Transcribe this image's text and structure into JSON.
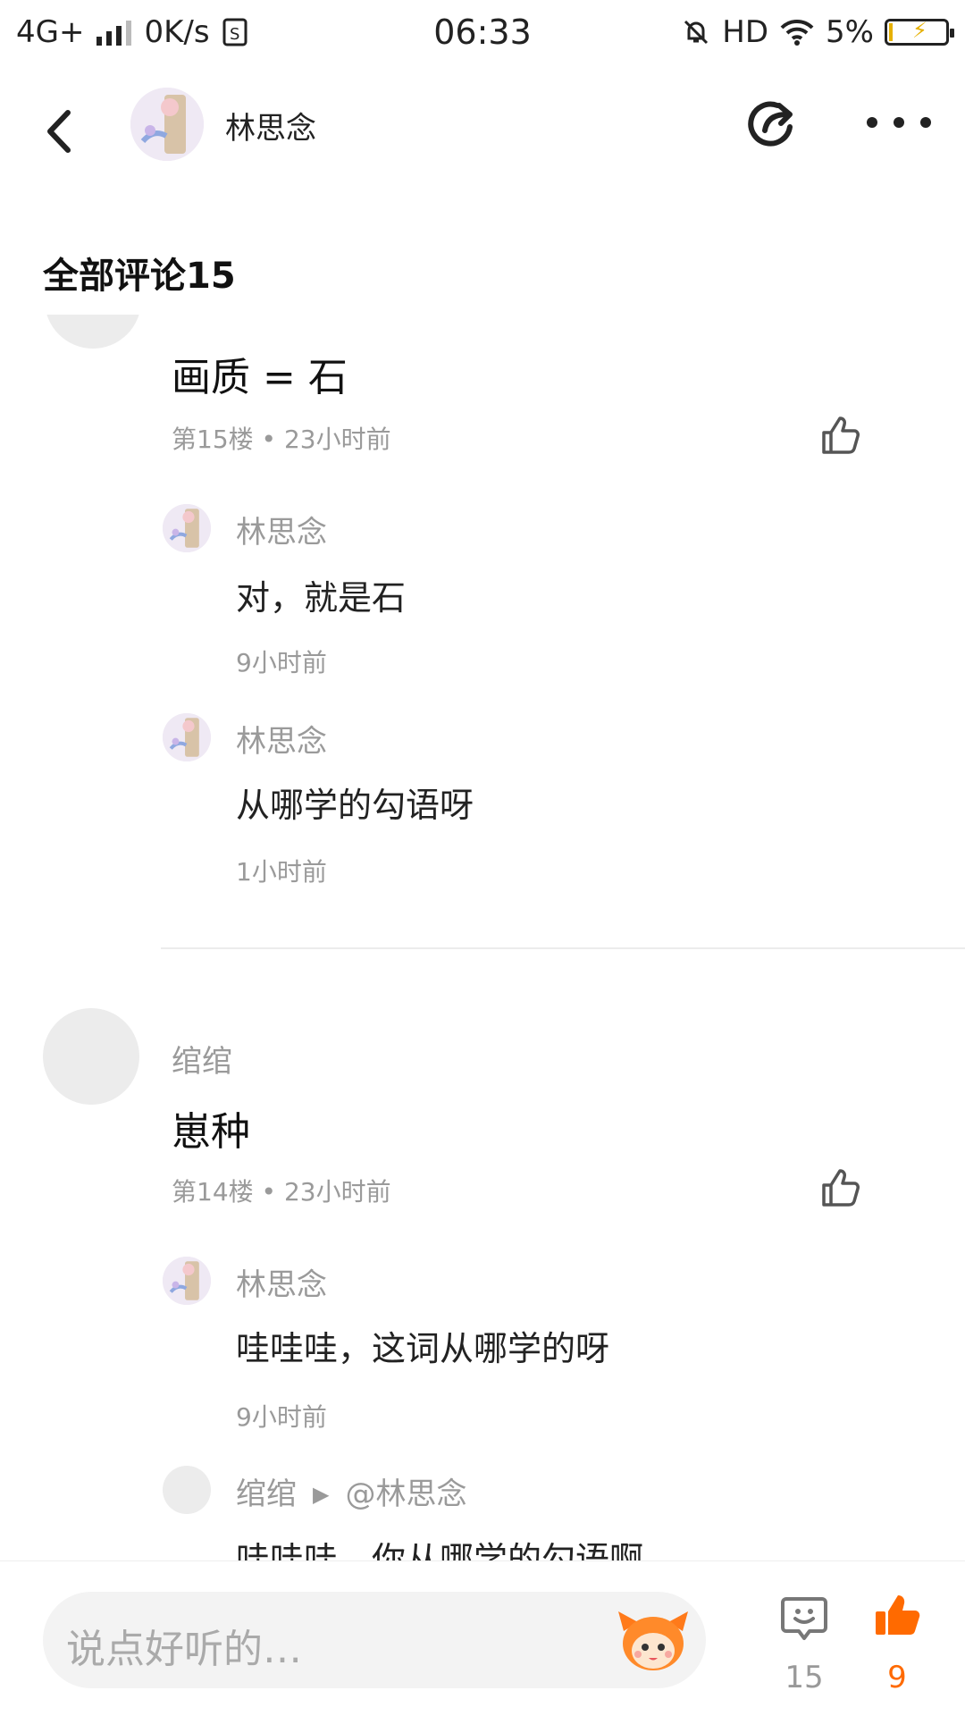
{
  "status_bar": {
    "network": "4G+",
    "speed": "0K/s",
    "time": "06:33",
    "hd": "HD",
    "battery_percent": "5%",
    "battery_level": 0.05
  },
  "header": {
    "user_name": "林思念"
  },
  "section": {
    "title": "全部评论15"
  },
  "comments": [
    {
      "text": "画质 = 石",
      "meta": "第15楼 • 23小时前",
      "replies": [
        {
          "name": "林思念",
          "text": "对，就是石",
          "time": "9小时前"
        },
        {
          "name": "林思念",
          "text": "从哪学的勾语呀",
          "time": "1小时前"
        }
      ]
    },
    {
      "author": "绾绾",
      "text": "崽种",
      "meta": "第14楼 • 23小时前",
      "replies": [
        {
          "name": "林思念",
          "text": "哇哇哇，这词从哪学的呀",
          "time": "9小时前"
        },
        {
          "name": "绾绾",
          "reply_to": "@林思念",
          "text": "哇哇哇，你从哪学的勾语啊"
        }
      ]
    }
  ],
  "bottom": {
    "placeholder": "说点好听的…",
    "comment_count": "15",
    "like_count": "9",
    "like_color": "#ff6a00"
  }
}
